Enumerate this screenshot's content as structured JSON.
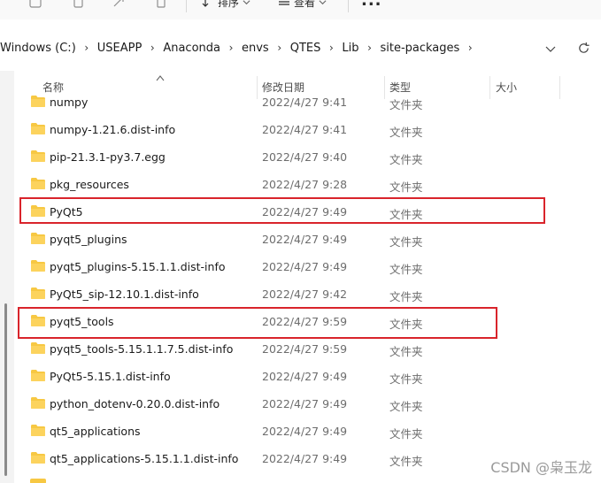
{
  "toolbar": {
    "sort_label": "排序",
    "view_label": "查看",
    "more_label": "..."
  },
  "address": {
    "crumbs": [
      "Windows (C:)",
      "USEAPP",
      "Anaconda",
      "envs",
      "QTES",
      "Lib",
      "site-packages"
    ]
  },
  "columns": {
    "name": "名称",
    "modified": "修改日期",
    "type": "类型",
    "size": "大小"
  },
  "rows": [
    {
      "name": "numpy",
      "date": "2022/4/27 9:41",
      "type": "文件夹"
    },
    {
      "name": "numpy-1.21.6.dist-info",
      "date": "2022/4/27 9:41",
      "type": "文件夹"
    },
    {
      "name": "pip-21.3.1-py3.7.egg",
      "date": "2022/4/27 9:40",
      "type": "文件夹"
    },
    {
      "name": "pkg_resources",
      "date": "2022/4/27 9:28",
      "type": "文件夹"
    },
    {
      "name": "PyQt5",
      "date": "2022/4/27 9:49",
      "type": "文件夹"
    },
    {
      "name": "pyqt5_plugins",
      "date": "2022/4/27 9:49",
      "type": "文件夹"
    },
    {
      "name": "pyqt5_plugins-5.15.1.1.dist-info",
      "date": "2022/4/27 9:49",
      "type": "文件夹"
    },
    {
      "name": "PyQt5_sip-12.10.1.dist-info",
      "date": "2022/4/27 9:42",
      "type": "文件夹"
    },
    {
      "name": "pyqt5_tools",
      "date": "2022/4/27 9:59",
      "type": "文件夹"
    },
    {
      "name": "pyqt5_tools-5.15.1.1.7.5.dist-info",
      "date": "2022/4/27 9:59",
      "type": "文件夹"
    },
    {
      "name": "PyQt5-5.15.1.dist-info",
      "date": "2022/4/27 9:49",
      "type": "文件夹"
    },
    {
      "name": "python_dotenv-0.20.0.dist-info",
      "date": "2022/4/27 9:49",
      "type": "文件夹"
    },
    {
      "name": "qt5_applications",
      "date": "2022/4/27 9:49",
      "type": "文件夹"
    },
    {
      "name": "qt5_applications-5.15.1.1.dist-info",
      "date": "2022/4/27 9:49",
      "type": "文件夹"
    }
  ],
  "highlighted_rows": [
    "PyQt5",
    "pyqt5_tools"
  ],
  "colors": {
    "highlight": "#d9242b",
    "folder": "#f7c843"
  },
  "icons": {
    "folder": "folder-icon",
    "sort": "sort-icon",
    "view": "view-icon",
    "refresh": "refresh-icon",
    "dropdown": "chevron-down-icon"
  },
  "watermark": "CSDN @枭玉龙"
}
